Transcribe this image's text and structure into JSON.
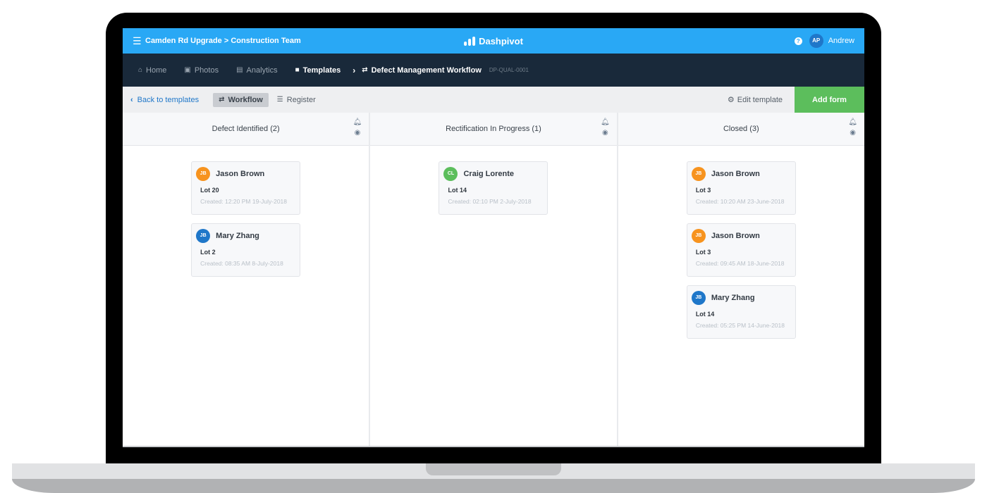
{
  "topbar": {
    "project_path": "Camden Rd Upgrade > Construction Team",
    "brand": "Dashpivot",
    "user_initials": "AP",
    "user_name": "Andrew",
    "accent_color": "#29a8f5"
  },
  "nav": {
    "items": [
      {
        "label": "Home",
        "icon": "home-icon"
      },
      {
        "label": "Photos",
        "icon": "camera-icon"
      },
      {
        "label": "Analytics",
        "icon": "chart-icon"
      },
      {
        "label": "Templates",
        "icon": "document-icon"
      }
    ],
    "breadcrumb_current": "Defect Management Workflow",
    "breadcrumb_code": "DP-QUAL-0001"
  },
  "toolbar": {
    "back_label": "Back to templates",
    "workflow_label": "Workflow",
    "register_label": "Register",
    "edit_template_label": "Edit template",
    "add_form_label": "Add form",
    "add_form_color": "#5cbe5c"
  },
  "columns": [
    {
      "title": "Defect Identified (2)",
      "cards": [
        {
          "initials": "JB",
          "name": "Jason Brown",
          "avatar_color": "#f7931e",
          "lot": "Lot 20",
          "created": "Created: 12:20 PM 19-July-2018"
        },
        {
          "initials": "JB",
          "name": "Mary Zhang",
          "avatar_color": "#1f77c9",
          "lot": "Lot 2",
          "created": "Created: 08:35 AM 8-July-2018"
        }
      ]
    },
    {
      "title": "Rectification In Progress (1)",
      "cards": [
        {
          "initials": "CL",
          "name": "Craig Lorente",
          "avatar_color": "#5cbe5c",
          "lot": "Lot 14",
          "created": "Created: 02:10 PM 2-July-2018"
        }
      ]
    },
    {
      "title": "Closed (3)",
      "cards": [
        {
          "initials": "JB",
          "name": "Jason Brown",
          "avatar_color": "#f7931e",
          "lot": "Lot 3",
          "created": "Created: 10:20 AM 23-June-2018"
        },
        {
          "initials": "JB",
          "name": "Jason Brown",
          "avatar_color": "#f7931e",
          "lot": "Lot 3",
          "created": "Created: 09:45 AM 18-June-2018"
        },
        {
          "initials": "JB",
          "name": "Mary Zhang",
          "avatar_color": "#1f77c9",
          "lot": "Lot 14",
          "created": "Created: 05:25 PM 14-June-2018"
        }
      ]
    }
  ]
}
